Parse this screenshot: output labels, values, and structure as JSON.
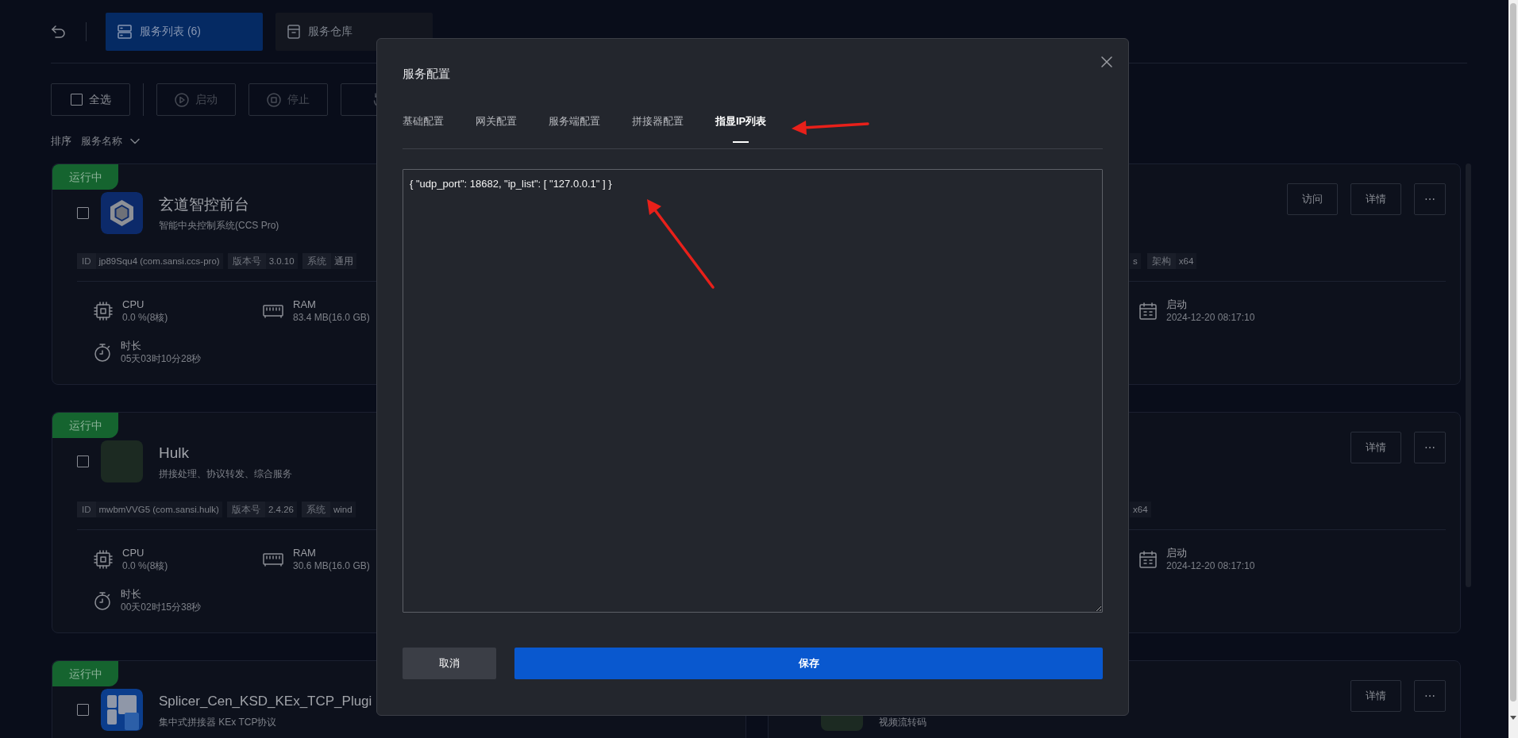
{
  "header": {
    "tabs": [
      {
        "label": "服务列表 (6)",
        "kind": "list",
        "selected": true
      },
      {
        "label": "服务仓库",
        "kind": "store",
        "selected": false
      }
    ]
  },
  "toolbar": {
    "select_all": {
      "label": "全选",
      "checked": false
    },
    "buttons": [
      {
        "label": "启动",
        "kind": "start",
        "disabled": true
      },
      {
        "label": "停止",
        "kind": "stop",
        "disabled": true
      },
      {
        "kind": "restart",
        "disabled": true
      }
    ]
  },
  "sort": {
    "label": "排序",
    "value": "服务名称"
  },
  "services": [
    {
      "kind": "wide",
      "status": "运行中",
      "checked": false,
      "logo": {
        "kind": "hexagon"
      },
      "name": "玄道智控前台",
      "description": "智能中央控制系统(CCS Pro)",
      "tags": [
        {
          "label": "ID",
          "value": "jp89Squ4 (com.sansi.ccs-pro)"
        },
        {
          "label": "版本号",
          "value": "3.0.10"
        },
        {
          "label": "系统",
          "value": "通用"
        }
      ],
      "stats": [
        {
          "kind": "cpu",
          "label": "CPU",
          "value": "0.0 %(8核)"
        },
        {
          "kind": "ram",
          "label": "RAM",
          "value": "83.4 MB(16.0 GB)"
        },
        {
          "kind": "uptime",
          "label": "时长",
          "value": "05天03时10分28秒"
        }
      ],
      "actions": [
        {
          "label": "访问",
          "kind": "text"
        },
        {
          "label": "详情",
          "kind": "text"
        },
        {
          "label": "⋯",
          "kind": "more"
        }
      ],
      "tags_right": [
        {
          "value": "s"
        },
        {
          "label": "架构",
          "value": "x64"
        }
      ],
      "stats_right": [
        {
          "kind": "started",
          "label": "启动",
          "value": "2024-12-20 08:17:10"
        }
      ]
    },
    {
      "kind": "wide",
      "status": "运行中",
      "checked": false,
      "logo": {
        "kind": "photo"
      },
      "name": "Hulk",
      "description": "拼接处理、协议转发、综合服务",
      "tags": [
        {
          "label": "ID",
          "value": "mwbmVVG5 (com.sansi.hulk)"
        },
        {
          "label": "版本号",
          "value": "2.4.26"
        },
        {
          "label": "系统",
          "value": "wind"
        }
      ],
      "stats": [
        {
          "kind": "cpu",
          "label": "CPU",
          "value": "0.0 %(8核)"
        },
        {
          "kind": "ram",
          "label": "RAM",
          "value": "30.6 MB(16.0 GB)"
        },
        {
          "kind": "uptime",
          "label": "时长",
          "value": "00天02时15分38秒"
        }
      ],
      "actions": [
        {
          "label": "详情",
          "kind": "text"
        },
        {
          "label": "⋯",
          "kind": "more"
        }
      ],
      "tags_right": [
        {
          "value": "x64"
        }
      ],
      "stats_right": [
        {
          "kind": "started",
          "label": "启动",
          "value": "2024-12-20 08:17:10"
        }
      ]
    },
    {
      "kind": "half",
      "status": "运行中",
      "checked": false,
      "logo": {
        "kind": "grid"
      },
      "name": "Splicer_Cen_KSD_KEx_TCP_Plugi",
      "description": "集中式拼接器 KEx TCP协议"
    },
    {
      "kind": "half",
      "logo": {
        "kind": "photo"
      },
      "description": "视频流转码",
      "actions": [
        {
          "label": "详情",
          "kind": "text"
        },
        {
          "label": "⋯",
          "kind": "more"
        }
      ]
    }
  ],
  "modal": {
    "title": "服务配置",
    "tabs": [
      {
        "label": "基础配置",
        "selected": false
      },
      {
        "label": "网关配置",
        "selected": false
      },
      {
        "label": "服务端配置",
        "selected": false
      },
      {
        "label": "拼接器配置",
        "selected": false
      },
      {
        "label": "指显IP列表",
        "selected": true
      }
    ],
    "editor": {
      "value": "{ \"udp_port\": 18682, \"ip_list\": [ \"127.0.0.1\" ] }"
    },
    "buttons": [
      {
        "label": "取消",
        "kind": "secondary"
      },
      {
        "label": "保存",
        "kind": "primary"
      }
    ]
  }
}
